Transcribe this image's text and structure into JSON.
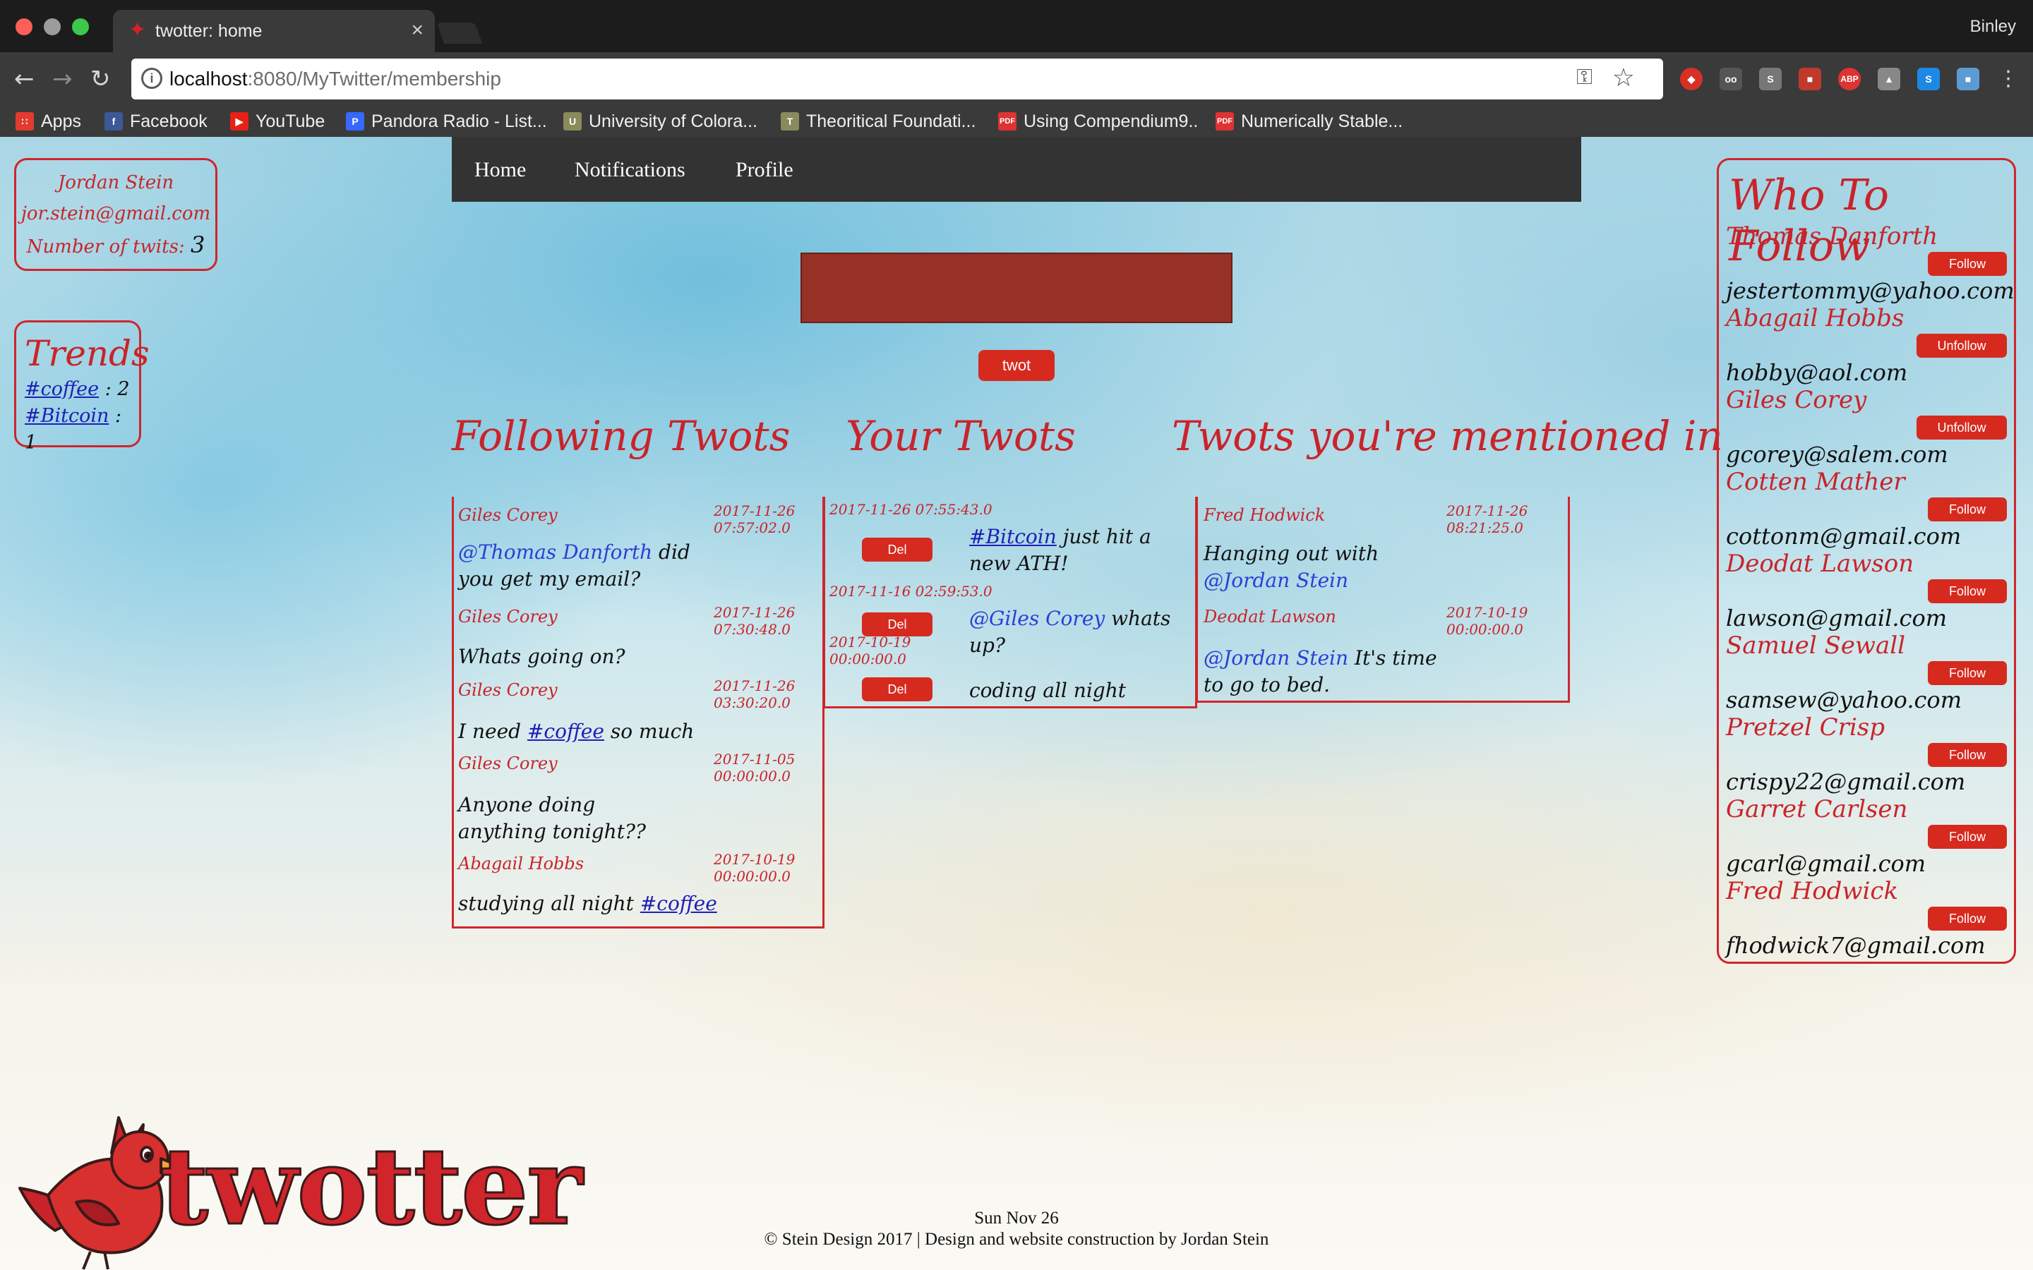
{
  "browser": {
    "tab_title": "twotter: home",
    "profile_name": "Binley",
    "url_host": "localhost",
    "url_path": ":8080/MyTwitter/membership",
    "bookmarks": [
      {
        "label": "Apps",
        "icon": "apps-grid-icon",
        "color": "#e33b2e"
      },
      {
        "label": "Facebook",
        "icon": "facebook-icon",
        "color": "#3b5998"
      },
      {
        "label": "YouTube",
        "icon": "youtube-icon",
        "color": "#e62117"
      },
      {
        "label": "Pandora Radio - List...",
        "icon": "pandora-icon",
        "color": "#3668ff"
      },
      {
        "label": "University of Colora...",
        "icon": "university-icon",
        "color": "#8a8a5c"
      },
      {
        "label": "Theoritical Foundati...",
        "icon": "book-icon",
        "color": "#8a8a5c"
      },
      {
        "label": "Using Compendium9..",
        "icon": "pdf-icon",
        "color": "#d33"
      },
      {
        "label": "Numerically Stable...",
        "icon": "pdf-icon",
        "color": "#d33"
      }
    ]
  },
  "profile": {
    "name": "Jordan Stein",
    "email": "jor.stein@gmail.com",
    "twits_label": "Number of twits:",
    "twits_count": "3"
  },
  "trends": {
    "title": "Trends",
    "items": [
      {
        "tag": "#coffee",
        "count": " : 2"
      },
      {
        "tag": "#Bitcoin",
        "count": " : 1"
      }
    ]
  },
  "nav": {
    "home": "Home",
    "notifications": "Notifications",
    "profile": "Profile"
  },
  "compose": {
    "button": "twot"
  },
  "columns": {
    "following": "Following Twots",
    "yours": "Your Twots",
    "mentioned": "Twots you're mentioned in"
  },
  "following_twots": [
    {
      "author": "Giles Corey",
      "date": "2017-11-26",
      "time": "07:57:02.0",
      "mention": "@Thomas Danforth",
      "text": " did you get my email?"
    },
    {
      "author": "Giles Corey",
      "date": "2017-11-26",
      "time": "07:30:48.0",
      "text": "Whats going on?"
    },
    {
      "author": "Giles Corey",
      "date": "2017-11-26",
      "time": "03:30:20.0",
      "pre": "I need ",
      "tag": "#coffee",
      "post": " so much"
    },
    {
      "author": "Giles Corey",
      "date": "2017-11-05",
      "time": "00:00:00.0",
      "text": "Anyone doing anything tonight??"
    },
    {
      "author": "Abagail Hobbs",
      "date": "2017-10-19",
      "time": "00:00:00.0",
      "pre": "studying all night ",
      "tag": "#coffee"
    }
  ],
  "your_twots": [
    {
      "stamp": "2017-11-26 07:55:43.0",
      "tag": "#Bitcoin",
      "text": " just hit a new ATH!",
      "del": "Del"
    },
    {
      "stamp": "2017-11-16 02:59:53.0",
      "mention": "@Giles Corey",
      "text": " whats up?",
      "del": "Del"
    },
    {
      "date": "2017-10-19",
      "time": "00:00:00.0",
      "text": "coding all night",
      "del": "Del"
    }
  ],
  "mentioned_twots": [
    {
      "author": "Fred Hodwick",
      "date": "2017-11-26",
      "time": "08:21:25.0",
      "pre": "Hanging out with ",
      "mention": "@Jordan Stein"
    },
    {
      "author": "Deodat Lawson",
      "date": "2017-10-19",
      "time": "00:00:00.0",
      "mention": "@Jordan Stein",
      "text": " It's time to go to bed."
    }
  ],
  "who_to_follow": {
    "title": "Who To Follow",
    "users": [
      {
        "name": "Thomas Danforth",
        "email": "jestertommy@yahoo.com",
        "action": "Follow"
      },
      {
        "name": "Abagail Hobbs",
        "email": "hobby@aol.com",
        "action": "Unfollow"
      },
      {
        "name": "Giles Corey",
        "email": "gcorey@salem.com",
        "action": "Unfollow"
      },
      {
        "name": "Cotten Mather",
        "email": "cottonm@gmail.com",
        "action": "Follow"
      },
      {
        "name": "Deodat Lawson",
        "email": "lawson@gmail.com",
        "action": "Follow"
      },
      {
        "name": "Samuel Sewall",
        "email": "samsew@yahoo.com",
        "action": "Follow"
      },
      {
        "name": "Pretzel Crisp",
        "email": "crispy22@gmail.com",
        "action": "Follow"
      },
      {
        "name": "Garret Carlsen",
        "email": "gcarl@gmail.com",
        "action": "Follow"
      },
      {
        "name": "Fred Hodwick",
        "email": "fhodwick7@gmail.com",
        "action": "Follow"
      }
    ]
  },
  "logo": {
    "text": "twotter"
  },
  "footer": {
    "date": "Sun Nov 26",
    "credits": "© Stein Design 2017 | Design and website construction by Jordan Stein"
  }
}
